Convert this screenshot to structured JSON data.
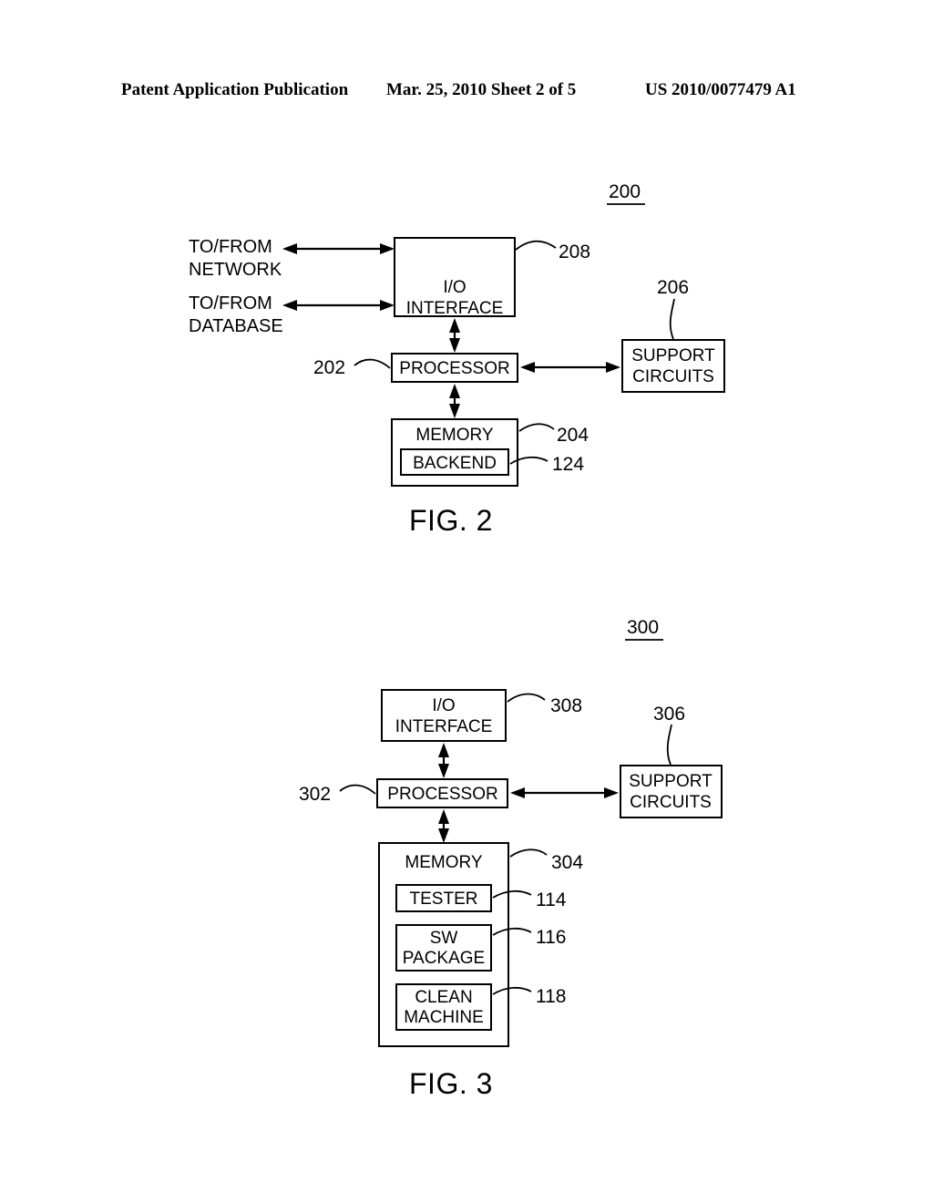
{
  "header": {
    "publication": "Patent Application Publication",
    "date_sheet": "Mar. 25, 2010  Sheet 2 of 5",
    "pub_number": "US 2010/0077479 A1"
  },
  "figures": [
    {
      "caption": "FIG. 2",
      "figure_ref": "200",
      "external_labels": [
        {
          "line1": "TO/FROM",
          "line2": "NETWORK"
        },
        {
          "line1": "TO/FROM",
          "line2": "DATABASE"
        }
      ],
      "blocks": [
        {
          "label_line1": "I/O",
          "label_line2": "INTERFACE",
          "ref": "208"
        },
        {
          "label_line1": "PROCESSOR",
          "label_line2": "",
          "ref": "202"
        },
        {
          "label_line1": "SUPPORT",
          "label_line2": "CIRCUITS",
          "ref": "206"
        },
        {
          "label_line1": "MEMORY",
          "label_line2": "",
          "ref": "204"
        },
        {
          "label_line1": "BACKEND",
          "label_line2": "",
          "ref": "124"
        }
      ]
    },
    {
      "caption": "FIG. 3",
      "figure_ref": "300",
      "external_labels": [],
      "blocks": [
        {
          "label_line1": "I/O",
          "label_line2": "INTERFACE",
          "ref": "308"
        },
        {
          "label_line1": "PROCESSOR",
          "label_line2": "",
          "ref": "302"
        },
        {
          "label_line1": "SUPPORT",
          "label_line2": "CIRCUITS",
          "ref": "306"
        },
        {
          "label_line1": "MEMORY",
          "label_line2": "",
          "ref": "304"
        },
        {
          "label_line1": "TESTER",
          "label_line2": "",
          "ref": "114"
        },
        {
          "label_line1": "SW",
          "label_line2": "PACKAGE",
          "ref": "116"
        },
        {
          "label_line1": "CLEAN",
          "label_line2": "MACHINE",
          "ref": "118"
        }
      ]
    }
  ],
  "colors": {
    "ink": "#000000",
    "paper": "#ffffff"
  }
}
